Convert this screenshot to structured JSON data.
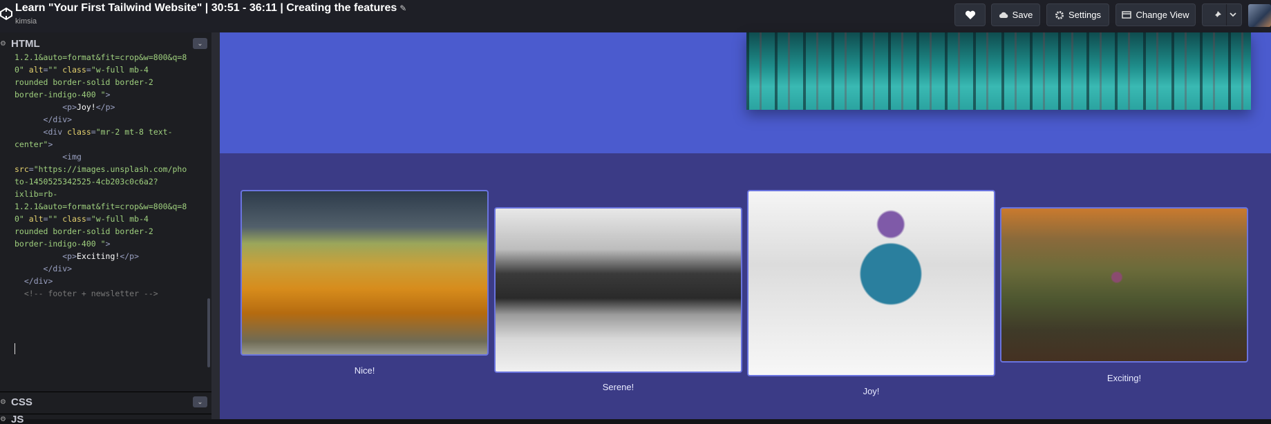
{
  "header": {
    "title": "Learn \"Your First Tailwind Website\" | 30:51 - 36:11 | Creating the features",
    "author": "kimsia",
    "buttons": {
      "save": "Save",
      "settings": "Settings",
      "change_view": "Change View"
    }
  },
  "editor": {
    "html_label": "HTML",
    "css_label": "CSS",
    "js_label": "JS",
    "code_lines": [
      {
        "parts": [
          {
            "c": "s",
            "t": "1.2.1&auto=format&fit=crop&w=800&q=8"
          }
        ]
      },
      {
        "parts": [
          {
            "c": "s",
            "t": "0\""
          },
          {
            "c": "a",
            "t": " alt"
          },
          {
            "c": "t",
            "t": "="
          },
          {
            "c": "s",
            "t": "\"\""
          },
          {
            "c": "a",
            "t": " class"
          },
          {
            "c": "t",
            "t": "="
          },
          {
            "c": "s",
            "t": "\"w-full mb-4"
          }
        ]
      },
      {
        "parts": [
          {
            "c": "s",
            "t": "rounded border-solid border-2"
          }
        ]
      },
      {
        "parts": [
          {
            "c": "s",
            "t": "border-indigo-400 \""
          },
          {
            "c": "t",
            "t": ">"
          }
        ]
      },
      {
        "parts": [
          {
            "c": "t",
            "t": "          <p>"
          },
          {
            "c": "w",
            "t": "Joy!"
          },
          {
            "c": "t",
            "t": "</p>"
          }
        ]
      },
      {
        "parts": [
          {
            "c": "t",
            "t": "      </div>"
          }
        ]
      },
      {
        "parts": [
          {
            "c": "t",
            "t": "      <div"
          },
          {
            "c": "a",
            "t": " class"
          },
          {
            "c": "t",
            "t": "="
          },
          {
            "c": "s",
            "t": "\"mr-2 mt-8 text-"
          }
        ]
      },
      {
        "parts": [
          {
            "c": "s",
            "t": "center\""
          },
          {
            "c": "t",
            "t": ">"
          }
        ]
      },
      {
        "parts": [
          {
            "c": "t",
            "t": "          <img"
          }
        ]
      },
      {
        "parts": [
          {
            "c": "a",
            "t": "src"
          },
          {
            "c": "t",
            "t": "="
          },
          {
            "c": "s",
            "t": "\"https://images.unsplash.com/pho"
          }
        ]
      },
      {
        "parts": [
          {
            "c": "s",
            "t": "to-1450525342525-4cb203c0c6a2?"
          }
        ]
      },
      {
        "parts": [
          {
            "c": "s",
            "t": "ixlib=rb-"
          }
        ]
      },
      {
        "parts": [
          {
            "c": "s",
            "t": "1.2.1&auto=format&fit=crop&w=800&q=8"
          }
        ]
      },
      {
        "parts": [
          {
            "c": "s",
            "t": "0\""
          },
          {
            "c": "a",
            "t": " alt"
          },
          {
            "c": "t",
            "t": "="
          },
          {
            "c": "s",
            "t": "\"\""
          },
          {
            "c": "a",
            "t": " class"
          },
          {
            "c": "t",
            "t": "="
          },
          {
            "c": "s",
            "t": "\"w-full mb-4"
          }
        ]
      },
      {
        "parts": [
          {
            "c": "s",
            "t": "rounded border-solid border-2"
          }
        ]
      },
      {
        "parts": [
          {
            "c": "s",
            "t": "border-indigo-400 \""
          },
          {
            "c": "t",
            "t": ">"
          }
        ]
      },
      {
        "parts": [
          {
            "c": "t",
            "t": "          <p>"
          },
          {
            "c": "w",
            "t": "Exciting!"
          },
          {
            "c": "t",
            "t": "</p>"
          }
        ]
      },
      {
        "parts": [
          {
            "c": "t",
            "t": "      </div>"
          }
        ]
      },
      {
        "parts": [
          {
            "c": "t",
            "t": "  </div>"
          }
        ]
      },
      {
        "parts": [
          {
            "c": "c",
            "t": "  <!-- footer + newsletter -->"
          }
        ]
      }
    ]
  },
  "preview": {
    "cards": [
      {
        "caption": "Nice!",
        "photo": "autumn-farmland-photo"
      },
      {
        "caption": "Serene!",
        "photo": "snowy-town-bw-photo"
      },
      {
        "caption": "Joy!",
        "photo": "skier-in-snow-photo"
      },
      {
        "caption": "Exciting!",
        "photo": "hot-air-balloon-photo"
      }
    ]
  },
  "colors": {
    "topbar_bg": "#1e1f26",
    "hero_bg": "#4b5bce",
    "section_bg": "#3b3b86",
    "card_border": "#6a74df"
  }
}
